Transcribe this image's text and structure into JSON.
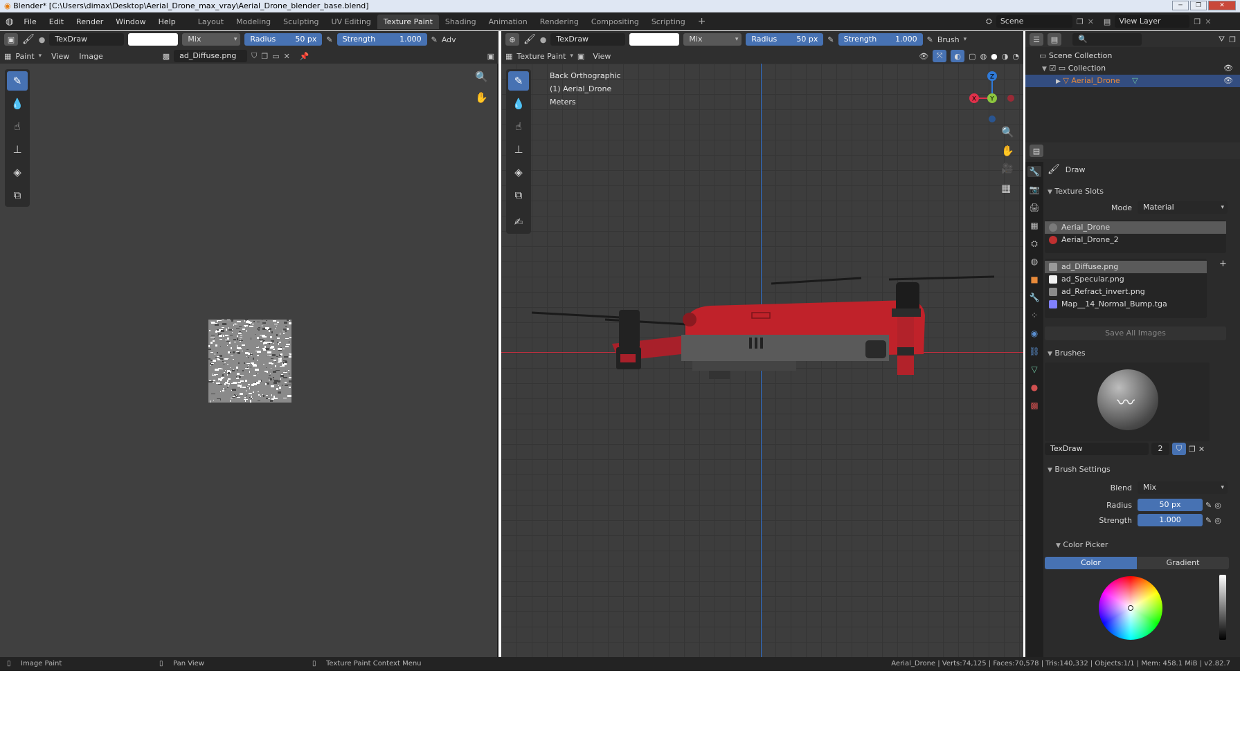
{
  "window": {
    "title": "Blender* [C:\\Users\\dimax\\Desktop\\Aerial_Drone_max_vray\\Aerial_Drone_blender_base.blend]"
  },
  "menu": [
    "File",
    "Edit",
    "Render",
    "Window",
    "Help"
  ],
  "workspaces": [
    "Layout",
    "Modeling",
    "Sculpting",
    "UV Editing",
    "Texture Paint",
    "Shading",
    "Animation",
    "Rendering",
    "Compositing",
    "Scripting"
  ],
  "active_workspace": "Texture Paint",
  "scene": {
    "name": "Scene",
    "view_layer": "View Layer"
  },
  "left_toolbar": {
    "brush_name": "TexDraw",
    "blend": "Mix",
    "radius_label": "Radius",
    "radius_value": "50 px",
    "strength_label": "Strength",
    "strength_value": "1.000",
    "adv": "Adv"
  },
  "image_editor": {
    "mode": "Paint",
    "menus": [
      "View",
      "Image"
    ],
    "image_name": "ad_Diffuse.png"
  },
  "viewport_toolbar": {
    "brush_name": "TexDraw",
    "blend": "Mix",
    "radius_label": "Radius",
    "radius_value": "50 px",
    "strength_label": "Strength",
    "strength_value": "1.000",
    "brush_menu": "Brush"
  },
  "viewport": {
    "mode": "Texture Paint",
    "view_menu": "View",
    "info": [
      "Back Orthographic",
      "(1) Aerial_Drone",
      "Meters"
    ],
    "axes": {
      "x": "X",
      "y": "Y",
      "z": "Z"
    }
  },
  "outliner": {
    "root": "Scene Collection",
    "collection": "Collection",
    "object": "Aerial_Drone"
  },
  "properties": {
    "tool_name": "Draw",
    "texture_slots": {
      "title": "Texture Slots",
      "mode_label": "Mode",
      "mode_value": "Material",
      "materials": [
        {
          "name": "Aerial_Drone",
          "color": "#7a7a7a"
        },
        {
          "name": "Aerial_Drone_2",
          "color": "#c03030"
        }
      ],
      "images": [
        {
          "name": "ad_Diffuse.png",
          "color": "#9a9a9a"
        },
        {
          "name": "ad_Specular.png",
          "color": "#f0f0f0"
        },
        {
          "name": "ad_Refract_invert.png",
          "color": "#8a8a8a"
        },
        {
          "name": "Map__14_Normal_Bump.tga",
          "color": "#8080ff"
        }
      ],
      "save_all": "Save All Images"
    },
    "brushes": {
      "title": "Brushes",
      "brush_name": "TexDraw",
      "users": "2"
    },
    "brush_settings": {
      "title": "Brush Settings",
      "blend_label": "Blend",
      "blend_value": "Mix",
      "radius_label": "Radius",
      "radius_value": "50 px",
      "strength_label": "Strength",
      "strength_value": "1.000"
    },
    "color_picker": {
      "title": "Color Picker",
      "tab_color": "Color",
      "tab_gradient": "Gradient"
    }
  },
  "statusbar": {
    "left": [
      "Image Paint",
      "Pan View",
      "Texture Paint Context Menu"
    ],
    "right": "Aerial_Drone | Verts:74,125 | Faces:70,578 | Tris:140,332 | Objects:1/1 | Mem: 458.1 MiB | v2.82.7"
  },
  "colors": {
    "accent": "#4772b3",
    "drone_red": "#c0222a",
    "axis_x": "#e0304a",
    "axis_y": "#8cc63f",
    "axis_z": "#2f7ad8"
  }
}
